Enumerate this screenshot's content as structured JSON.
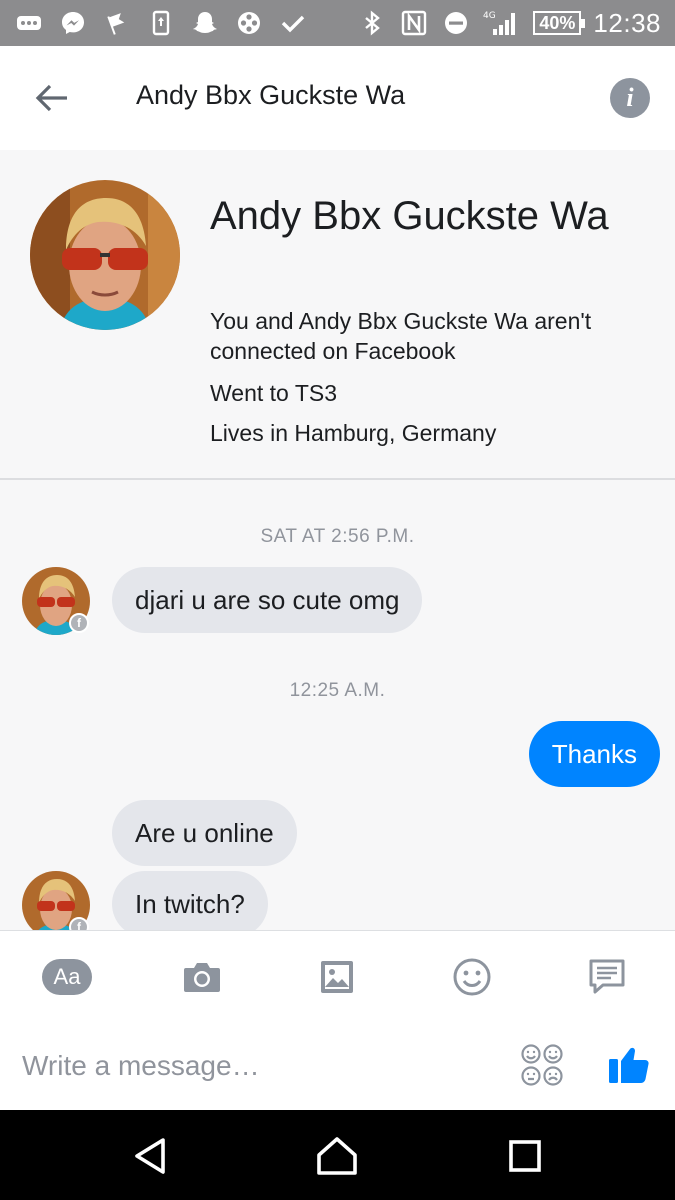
{
  "status_bar": {
    "icons": [
      "more-icon",
      "messenger-icon",
      "flag-icon",
      "screen-rotation-icon",
      "snapchat-icon",
      "video-reel-icon",
      "check-icon"
    ],
    "right_icons": [
      "bluetooth-icon",
      "nfc-icon",
      "do-not-disturb-icon",
      "signal-4g-icon"
    ],
    "network": "4G",
    "battery": "40%",
    "time": "12:38"
  },
  "header": {
    "title": "Andy Bbx Guckste Wa"
  },
  "profile": {
    "name": "Andy Bbx Guckste Wa",
    "connection_text": "You and Andy Bbx Guckste Wa aren't connected on Facebook",
    "education": "Went to TS3",
    "location": "Lives in Hamburg, Germany"
  },
  "messages": {
    "timestamp_1": "SAT AT 2:56 P.M.",
    "msg_1": "djari u are so cute omg",
    "timestamp_2": "12:25 A.M.",
    "msg_2": "Thanks",
    "msg_3": "Are u online",
    "msg_4": "In twitch?"
  },
  "composer": {
    "aa_label": "Aa",
    "placeholder": "Write a message…"
  },
  "colors": {
    "accent": "#0084ff",
    "incoming_bubble": "#e4e6eb",
    "status_bar": "#8c8c8e"
  }
}
